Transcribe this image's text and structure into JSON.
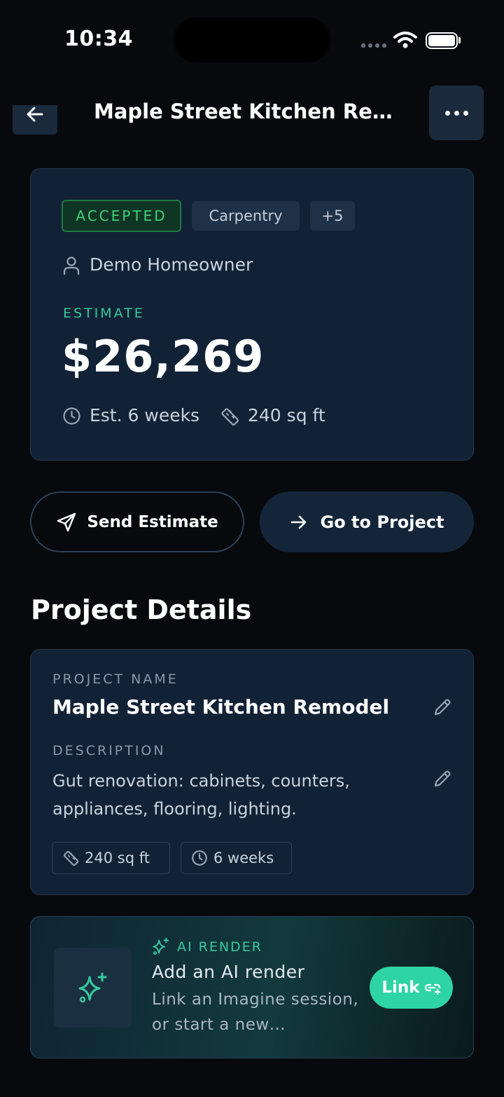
{
  "status_bar": {
    "time": "10:34"
  },
  "header": {
    "title": "Maple Street Kitchen Remodel"
  },
  "estimate_card": {
    "status_badge": "ACCEPTED",
    "trade_tag": "Carpentry",
    "more_tags": "+5",
    "homeowner": "Demo Homeowner",
    "estimate_label": "ESTIMATE",
    "estimate_value": "$26,269",
    "duration": "Est. 6 weeks",
    "area": "240 sq ft"
  },
  "actions": {
    "send_label": "Send Estimate",
    "go_label": "Go to Project"
  },
  "project_details": {
    "section_title": "Project Details",
    "name_label": "PROJECT NAME",
    "name_value": "Maple Street Kitchen Remodel",
    "description_label": "DESCRIPTION",
    "description_value": "Gut renovation: cabinets, counters, appliances, flooring, lighting.",
    "chips": {
      "area": "240 sq ft",
      "duration": "6 weeks"
    }
  },
  "ai_render": {
    "label": "AI RENDER",
    "title": "Add an AI render",
    "subtitle": "Link an Imagine session, or start a new…",
    "button_label": "Link"
  },
  "colors": {
    "background": "#07090d",
    "card": "#122236",
    "accent_teal": "#35c9a0",
    "accepted_green": "#3fd07a",
    "link_button": "#2fd4a4"
  }
}
